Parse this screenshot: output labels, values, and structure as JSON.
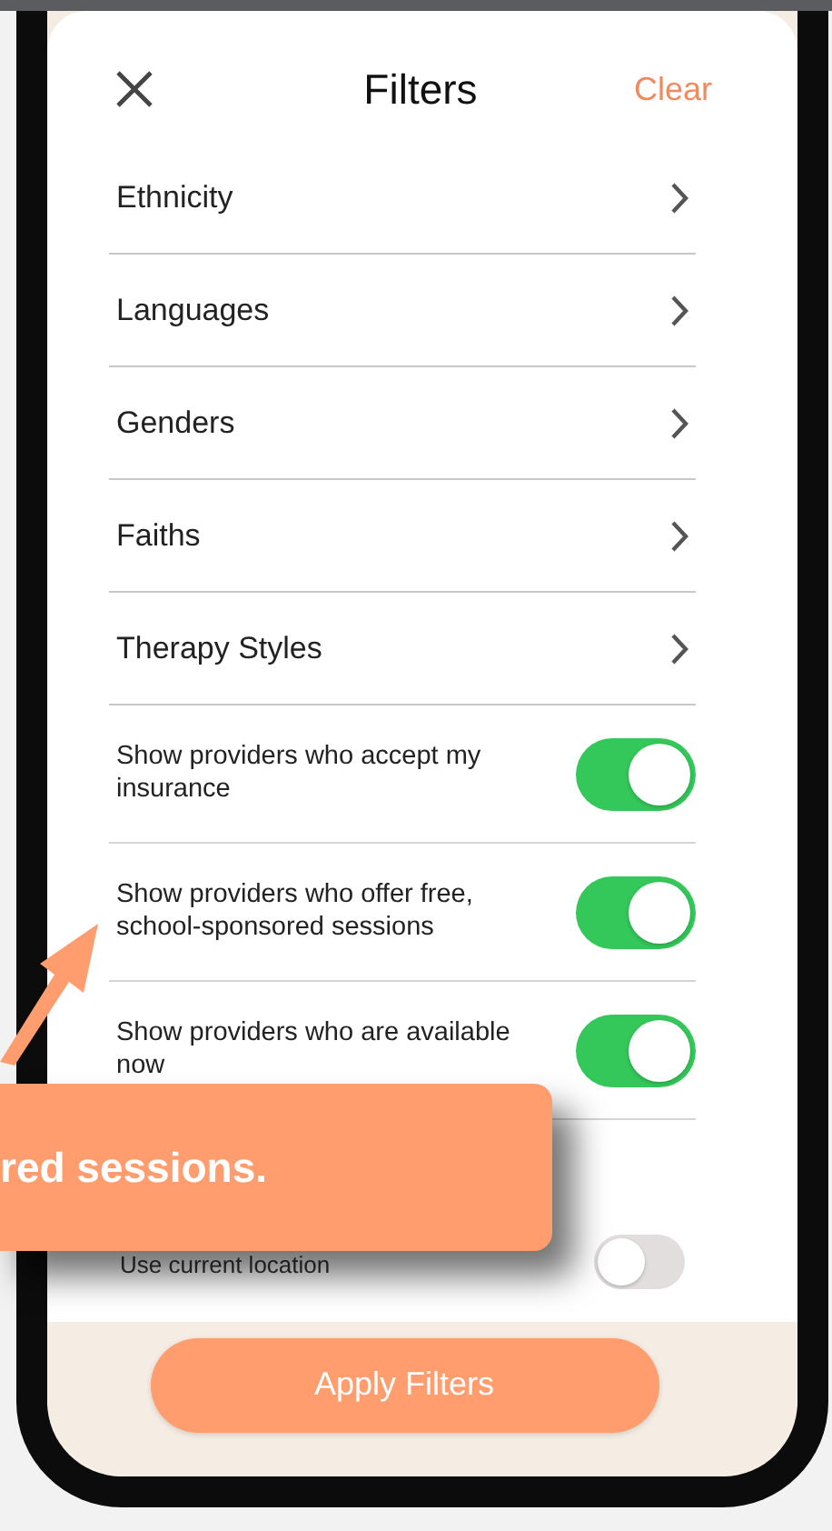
{
  "header": {
    "title": "Filters",
    "clear": "Clear"
  },
  "nav_items": [
    {
      "label": "Ethnicity"
    },
    {
      "label": "Languages"
    },
    {
      "label": "Genders"
    },
    {
      "label": "Faiths"
    },
    {
      "label": "Therapy Styles"
    }
  ],
  "toggles": [
    {
      "label": "Show providers who accept my insurance",
      "on": true
    },
    {
      "label": "Show providers who offer free, school-sponsored sessions",
      "on": true
    },
    {
      "label": "Show providers who are available now",
      "on": true
    }
  ],
  "location": {
    "label": "Use current location",
    "on": false
  },
  "apply_button": "Apply Filters",
  "callout": {
    "text": "red sessions."
  }
}
